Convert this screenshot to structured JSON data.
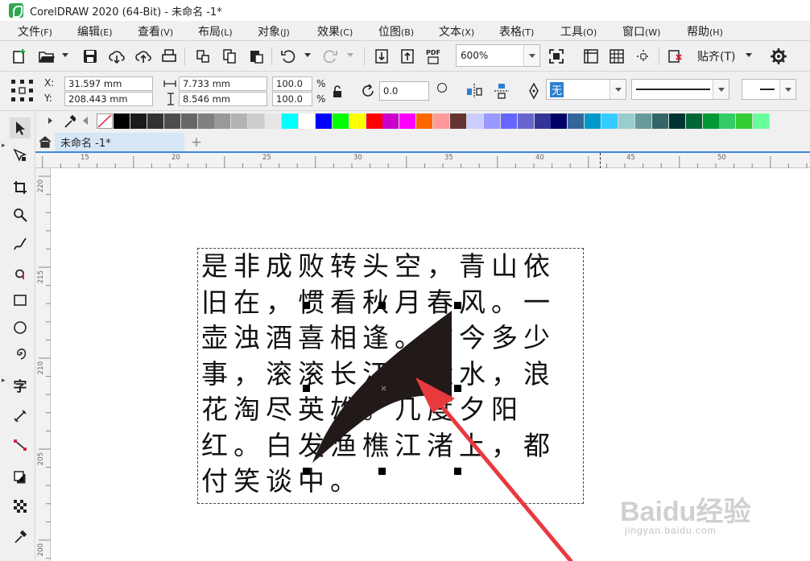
{
  "title": "CorelDRAW 2020 (64-Bit) - 未命名 -1*",
  "menu": [
    {
      "label": "文件",
      "acc": "(F)"
    },
    {
      "label": "编辑",
      "acc": "(E)"
    },
    {
      "label": "查看",
      "acc": "(V)"
    },
    {
      "label": "布局",
      "acc": "(L)"
    },
    {
      "label": "对象",
      "acc": "(J)"
    },
    {
      "label": "效果",
      "acc": "(C)"
    },
    {
      "label": "位图",
      "acc": "(B)"
    },
    {
      "label": "文本",
      "acc": "(X)"
    },
    {
      "label": "表格",
      "acc": "(T)"
    },
    {
      "label": "工具",
      "acc": "(O)"
    },
    {
      "label": "窗口",
      "acc": "(W)"
    },
    {
      "label": "帮助",
      "acc": "(H)"
    }
  ],
  "toolbar": {
    "zoom": "600%",
    "snap_label": "贴齐(T)",
    "pdf_label": "PDF"
  },
  "props": {
    "x_label": "X:",
    "y_label": "Y:",
    "x_value": "31.597 mm",
    "y_value": "208.443 mm",
    "w_value": "7.733 mm",
    "h_value": "8.546 mm",
    "scale_x": "100.0",
    "scale_y": "100.0",
    "percent": "%",
    "rotation": "0.0",
    "fill_none": "无"
  },
  "palette": [
    "#ffffff",
    "#000000",
    "#1a1a1a",
    "#333333",
    "#4d4d4d",
    "#666666",
    "#808080",
    "#999999",
    "#b3b3b3",
    "#cccccc",
    "#e6e6e6",
    "#00ffff",
    "#ffffff",
    "#0000ff",
    "#00ff00",
    "#ffff00",
    "#ff0000",
    "#cc00cc",
    "#ff00ff",
    "#ff6600",
    "#ff9999",
    "#663333",
    "#ccccff",
    "#9999ff",
    "#6666ff",
    "#6666cc",
    "#333399",
    "#000066",
    "#336699",
    "#0099cc",
    "#33ccff",
    "#99cccc",
    "#669999",
    "#336666",
    "#003333",
    "#006633",
    "#009933",
    "#33cc66",
    "#33cc33",
    "#66ff99"
  ],
  "tab": {
    "label": "未命名 -1*"
  },
  "hruler": {
    "labels": [
      "15",
      "20",
      "25",
      "30",
      "35",
      "40",
      "45",
      "50"
    ]
  },
  "vruler": {
    "labels": [
      "220",
      "215",
      "210",
      "205",
      "200"
    ]
  },
  "document": {
    "lines": [
      "是非成败转头空，青山依",
      "旧在，惯看秋月春风。一",
      "壶浊酒喜相逢。古今多少",
      "事，滚滚长江东逝水，浪",
      "花淘尽英雄。几度夕阳",
      "红。白发渔樵江渚上，都",
      "付笑谈中。"
    ]
  },
  "watermark": {
    "logo": "Baidu经验",
    "url": "jingyan.baidu.com"
  }
}
